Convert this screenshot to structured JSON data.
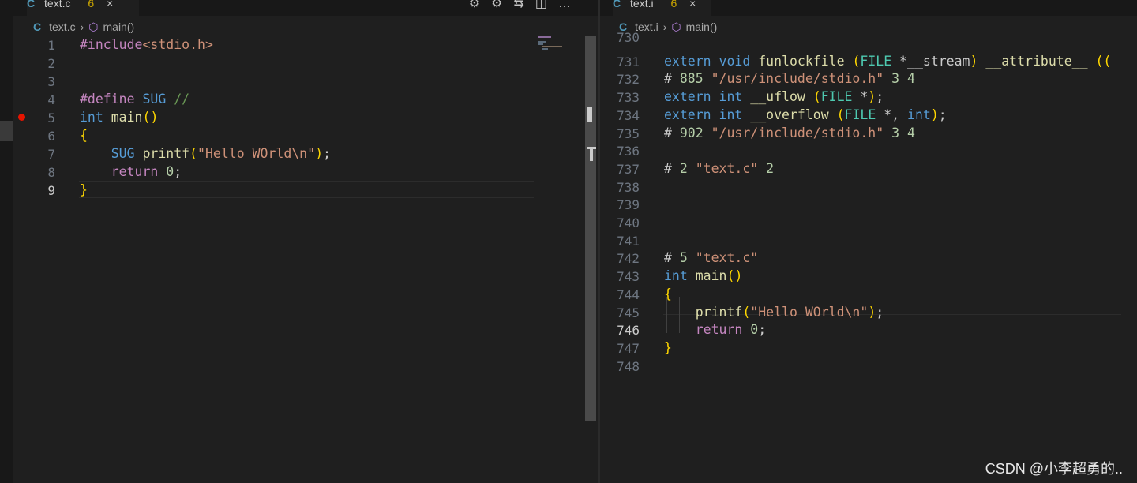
{
  "left_editor": {
    "tab": {
      "icon": "C",
      "name": "text.c",
      "badge": "6",
      "close": "×"
    },
    "breadcrumb": {
      "file": "text.c",
      "symbol": "main()"
    },
    "lines": [
      {
        "n": "1",
        "text": "#include<stdio.h>"
      },
      {
        "n": "2",
        "text": ""
      },
      {
        "n": "3",
        "text": ""
      },
      {
        "n": "4",
        "text": "#define SUG //"
      },
      {
        "n": "5",
        "text": "int main()"
      },
      {
        "n": "6",
        "text": "{"
      },
      {
        "n": "7",
        "text": "    SUG printf(\"Hello WOrld\\n\");"
      },
      {
        "n": "8",
        "text": "    return 0;"
      },
      {
        "n": "9",
        "text": "}"
      }
    ],
    "active_line": "9",
    "breakpoint_line": "5"
  },
  "right_editor": {
    "tab": {
      "icon": "C",
      "name": "text.i",
      "badge": "6",
      "close": "×"
    },
    "breadcrumb": {
      "file": "text.i",
      "symbol": "main()"
    },
    "lines": [
      {
        "n": "730",
        "text": ""
      },
      {
        "n": "731",
        "text": "extern void funlockfile (FILE *__stream) __attribute__ (("
      },
      {
        "n": "732",
        "text": "# 885 \"/usr/include/stdio.h\" 3 4"
      },
      {
        "n": "733",
        "text": "extern int __uflow (FILE *);"
      },
      {
        "n": "734",
        "text": "extern int __overflow (FILE *, int);"
      },
      {
        "n": "735",
        "text": "# 902 \"/usr/include/stdio.h\" 3 4"
      },
      {
        "n": "736",
        "text": ""
      },
      {
        "n": "737",
        "text": "# 2 \"text.c\" 2"
      },
      {
        "n": "738",
        "text": ""
      },
      {
        "n": "739",
        "text": ""
      },
      {
        "n": "740",
        "text": ""
      },
      {
        "n": "741",
        "text": ""
      },
      {
        "n": "742",
        "text": "# 5 \"text.c\""
      },
      {
        "n": "743",
        "text": "int main()"
      },
      {
        "n": "744",
        "text": "{"
      },
      {
        "n": "745",
        "text": "    printf(\"Hello WOrld\\n\");"
      },
      {
        "n": "746",
        "text": "    return 0;"
      },
      {
        "n": "747",
        "text": "}"
      },
      {
        "n": "748",
        "text": ""
      }
    ],
    "active_line": "746"
  },
  "toolbar_icons": [
    "debug-icon",
    "gear-icon",
    "compare-icon",
    "split-editor-icon",
    "more-icon"
  ],
  "watermark": "CSDN @小李超勇的.."
}
